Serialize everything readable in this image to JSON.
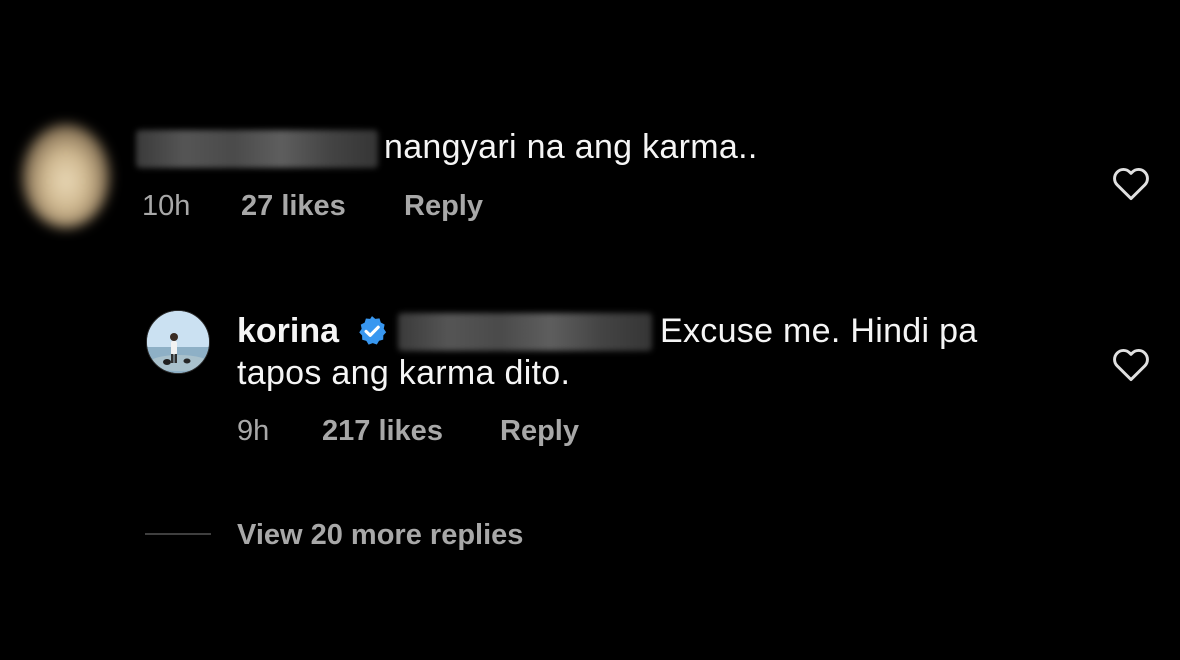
{
  "comment1": {
    "text": "nangyari na ang karma..",
    "time": "10h",
    "likes": "27 likes",
    "reply": "Reply",
    "like_icon": "heart-outline-icon"
  },
  "comment2": {
    "username": "korina",
    "verified_icon": "verified-badge-icon",
    "text_line1": "Excuse me. Hindi pa",
    "text_line2": "tapos ang karma dito.",
    "time": "9h",
    "likes": "217 likes",
    "reply": "Reply",
    "like_icon": "heart-outline-icon"
  },
  "view_replies": "View 20 more replies",
  "colors": {
    "background": "#000000",
    "text": "#f5f5f5",
    "meta": "#a8a8a8",
    "verified": "#3897f0"
  }
}
